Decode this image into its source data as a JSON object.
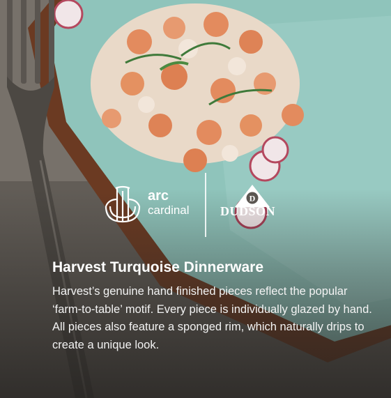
{
  "brands": {
    "arc": {
      "name": "arc",
      "sub": "cardinal"
    },
    "dudson": {
      "name": "DUDSON",
      "mark_letter": "D"
    }
  },
  "product": {
    "title": "Harvest Turquoise Dinnerware",
    "description": "Harvest’s genuine hand finished pieces reflect the popular ‘farm-to-table’ motif. Every piece is individually glazed by hand. All pieces also feature a sponged rim, which naturally drips to create a unique look."
  },
  "colors": {
    "plate": "#8fc4bb",
    "rim": "#6b3a22",
    "text": "#ffffff"
  }
}
